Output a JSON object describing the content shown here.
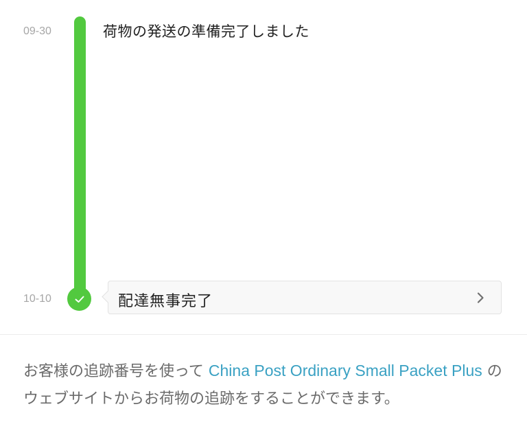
{
  "timeline": {
    "events": [
      {
        "date": "09-30",
        "text": "荷物の発送の準備完了しました"
      },
      {
        "date": "10-10",
        "text": "配達無事完了"
      }
    ]
  },
  "info": {
    "prefix": "お客様の追跡番号を使って ",
    "link": "China Post Ordinary Small Packet Plus",
    "suffix": " のウェブサイトからお荷物の追跡をすることができます。"
  },
  "icons": {
    "check": "check-icon",
    "chevron": "chevron-right-icon"
  },
  "colors": {
    "accent_green": "#52c93f",
    "link_blue": "#3aa1c3",
    "date_gray": "#a6a6a6",
    "body_text": "#6b6b6b",
    "card_bg": "#f8f8f8"
  }
}
